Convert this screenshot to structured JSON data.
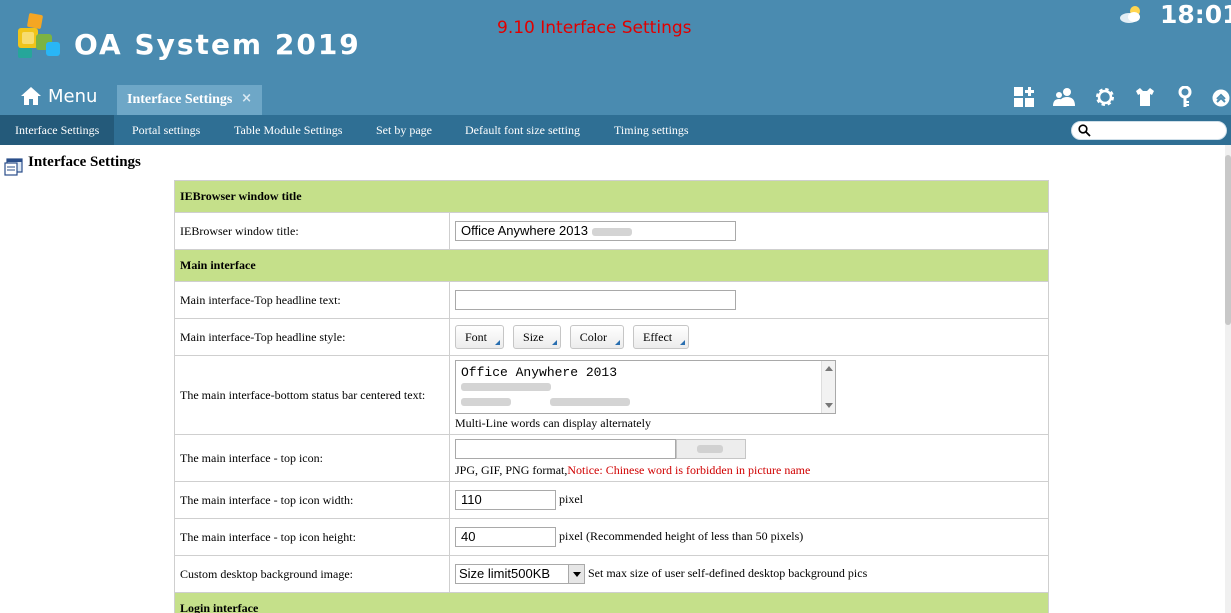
{
  "header": {
    "app_title": "OA System 2019",
    "banner_note": "9.10 Interface Settings",
    "clock": "18:01",
    "menu_label": "Menu",
    "active_tab": "Interface Settings",
    "tab_close": "×"
  },
  "subnav": {
    "items": [
      {
        "label": "Interface Settings"
      },
      {
        "label": "Portal settings"
      },
      {
        "label": "Table Module Settings"
      },
      {
        "label": "Set by page"
      },
      {
        "label": "Default font size setting"
      },
      {
        "label": "Timing settings"
      }
    ],
    "search_placeholder": ""
  },
  "page": {
    "title": "Interface Settings"
  },
  "form": {
    "sec_ie": "IEBrowser window title",
    "ie_title_label": "IEBrowser window title:",
    "ie_title_value": "Office Anywhere 2013",
    "sec_main": "Main interface",
    "top_text_label": "Main interface-Top headline text:",
    "top_text_value": "",
    "top_style_label": "Main interface-Top headline style:",
    "style_buttons": {
      "font": "Font",
      "size": "Size",
      "color": "Color",
      "effect": "Effect"
    },
    "status_label": "The main interface-bottom status bar centered text:",
    "status_value": "Office Anywhere 2013",
    "status_hint": "Multi-Line words can display alternately",
    "top_icon_label": "The main interface - top icon:",
    "top_icon_hint": "JPG, GIF, PNG format,",
    "top_icon_notice": "Notice: Chinese word is forbidden in picture name",
    "icon_width_label": "The main interface - top icon width:",
    "icon_width_value": "110",
    "icon_width_unit": "pixel",
    "icon_height_label": "The main interface - top icon height:",
    "icon_height_value": "40",
    "icon_height_unit": "pixel (Recommended height of less than 50 pixels)",
    "bg_label": "Custom desktop background image:",
    "bg_select": "Size limit500KB",
    "bg_hint": "Set max size of user self-defined desktop background pics",
    "sec_login": "Login interface"
  },
  "colors": {
    "header_bg": "#4a8bb0",
    "subnav_bg": "#2f6f94",
    "section_bg": "#c5e08a",
    "notice": "#d00000"
  },
  "icons": [
    "logo-icon",
    "weather-icon",
    "home-icon",
    "apps-icon",
    "users-icon",
    "gear-icon",
    "shirt-icon",
    "key-icon",
    "collapse-up-icon",
    "search-icon",
    "settings-page-icon"
  ]
}
